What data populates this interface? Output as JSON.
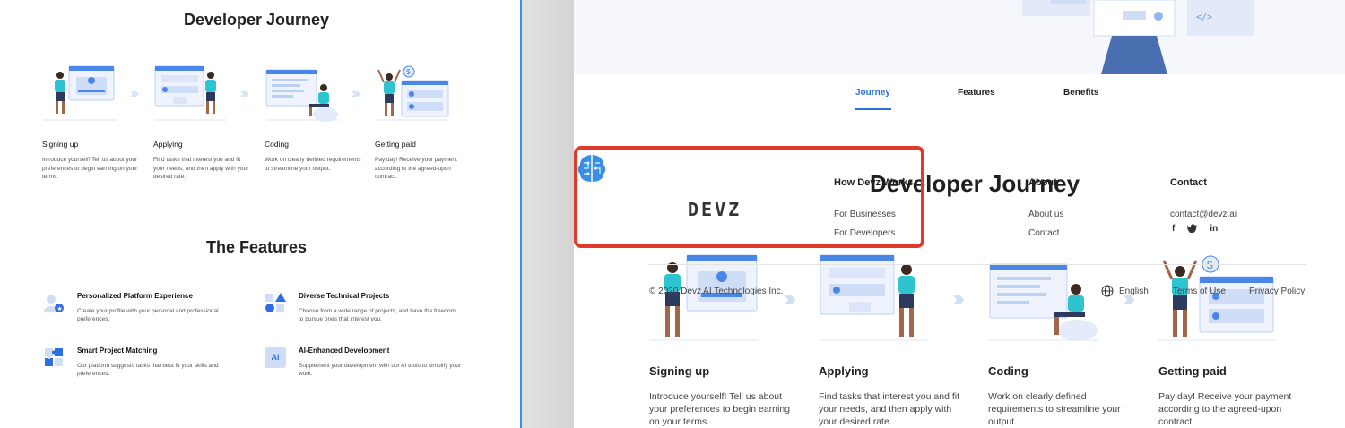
{
  "left_panel": {
    "journey_title": "Developer Journey",
    "steps": [
      {
        "title": "Signing up",
        "desc": "Introduce yourself! Tell us about your preferences to begin earning on your terms."
      },
      {
        "title": "Applying",
        "desc": "Find tasks that interest you and fit your needs, and then apply with your desired rate."
      },
      {
        "title": "Coding",
        "desc": "Work on clearly defined requirements to streamline your output."
      },
      {
        "title": "Getting paid",
        "desc": "Pay day! Receive your payment according to the agreed-upon contract."
      }
    ],
    "features_title": "The Features",
    "features": [
      {
        "title": "Personalized Platform Experience",
        "desc": "Create your profile with your personal and professional preferences.",
        "icon": "user-star-icon"
      },
      {
        "title": "Diverse Technical Projects",
        "desc": "Choose from a wide range of projects, and have the freedom to pursue ones that interest you.",
        "icon": "shapes-icon"
      },
      {
        "title": "Smart Project Matching",
        "desc": "Our platform suggests tasks that best fit your skills and preferences.",
        "icon": "puzzle-icon"
      },
      {
        "title": "AI-Enhanced Development",
        "desc": "Supplement your development with our AI tools to simplify your work.",
        "icon": "ai-icon",
        "badge": "AI"
      }
    ]
  },
  "right_panel": {
    "tabs": [
      {
        "label": "Journey",
        "active": true
      },
      {
        "label": "Features",
        "active": false
      },
      {
        "label": "Benefits",
        "active": false
      }
    ],
    "journey_title": "Developer Journey",
    "logo_text": "DEVZ",
    "footer": {
      "how_title": "How Devz Works",
      "how_links": [
        "For Businesses",
        "For Developers"
      ],
      "about_title": "About",
      "about_links": [
        "About us",
        "Contact"
      ],
      "contact_title": "Contact",
      "contact_email": "contact@devz.ai",
      "social": [
        "f",
        "t",
        "in"
      ],
      "copyright": "© 2020 Devz AI Technologies Inc.",
      "language": "English",
      "terms": "Terms of Use",
      "privacy": "Privacy Policy"
    },
    "steps": [
      {
        "title": "Signing up",
        "desc": "Introduce yourself! Tell us about your preferences to begin earning on your terms."
      },
      {
        "title": "Applying",
        "desc": "Find tasks that interest you and fit your needs, and then apply with your desired rate."
      },
      {
        "title": "Coding",
        "desc": "Work on clearly defined requirements to streamline your output."
      },
      {
        "title": "Getting paid",
        "desc": "Pay day! Receive your payment according to the agreed-upon contract."
      }
    ]
  },
  "colors": {
    "accent": "#2c6fe0",
    "highlight": "#e03a2a",
    "teal": "#2ec4cf",
    "divider": "#3b8fe6"
  }
}
